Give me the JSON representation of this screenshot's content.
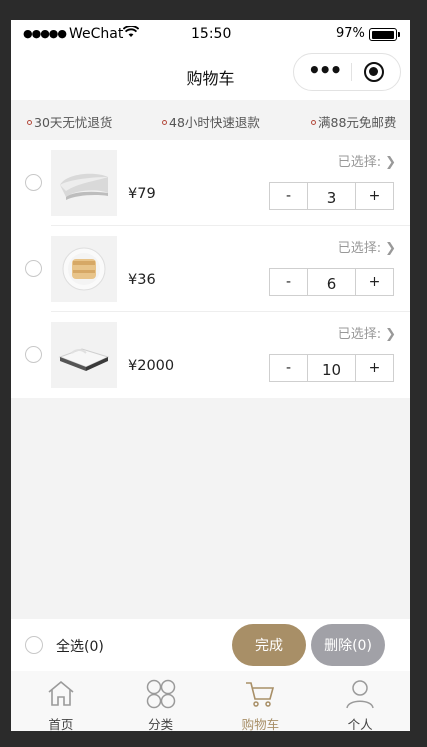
{
  "status_bar": {
    "signal": "●●●●●",
    "carrier": "WeChat",
    "time": "15:50",
    "battery_pct": "97%",
    "battery_level": 0.97
  },
  "navbar": {
    "title": "购物车",
    "more_icon": "more-dots-icon",
    "close_icon": "target-close-icon"
  },
  "services": [
    {
      "label": "30天无忧退货"
    },
    {
      "label": "48小时快速退款"
    },
    {
      "label": "满88元免邮费"
    }
  ],
  "cart": {
    "items": [
      {
        "product": "pillow",
        "price": "¥79",
        "spec_label": "已选择:",
        "minus": "-",
        "quantity": "3",
        "plus": "+"
      },
      {
        "product": "food-plate",
        "price": "¥36",
        "spec_label": "已选择:",
        "minus": "-",
        "quantity": "6",
        "plus": "+"
      },
      {
        "product": "towel-box",
        "price": "¥2000",
        "spec_label": "已选择:",
        "minus": "-",
        "quantity": "10",
        "plus": "+"
      }
    ]
  },
  "action_bar": {
    "select_all": "全选(0)",
    "done": "完成",
    "delete": "删除(0)"
  },
  "colors": {
    "accent": "#a88f67",
    "delete_button": "#a1a1a7",
    "service_dot": "#b34a3c"
  },
  "tabbar": {
    "tabs": [
      {
        "label": "首页",
        "icon": "home-icon",
        "active": false
      },
      {
        "label": "分类",
        "icon": "category-icon",
        "active": false
      },
      {
        "label": "购物车",
        "icon": "cart-icon",
        "active": true
      },
      {
        "label": "个人",
        "icon": "person-icon",
        "active": false
      }
    ]
  }
}
